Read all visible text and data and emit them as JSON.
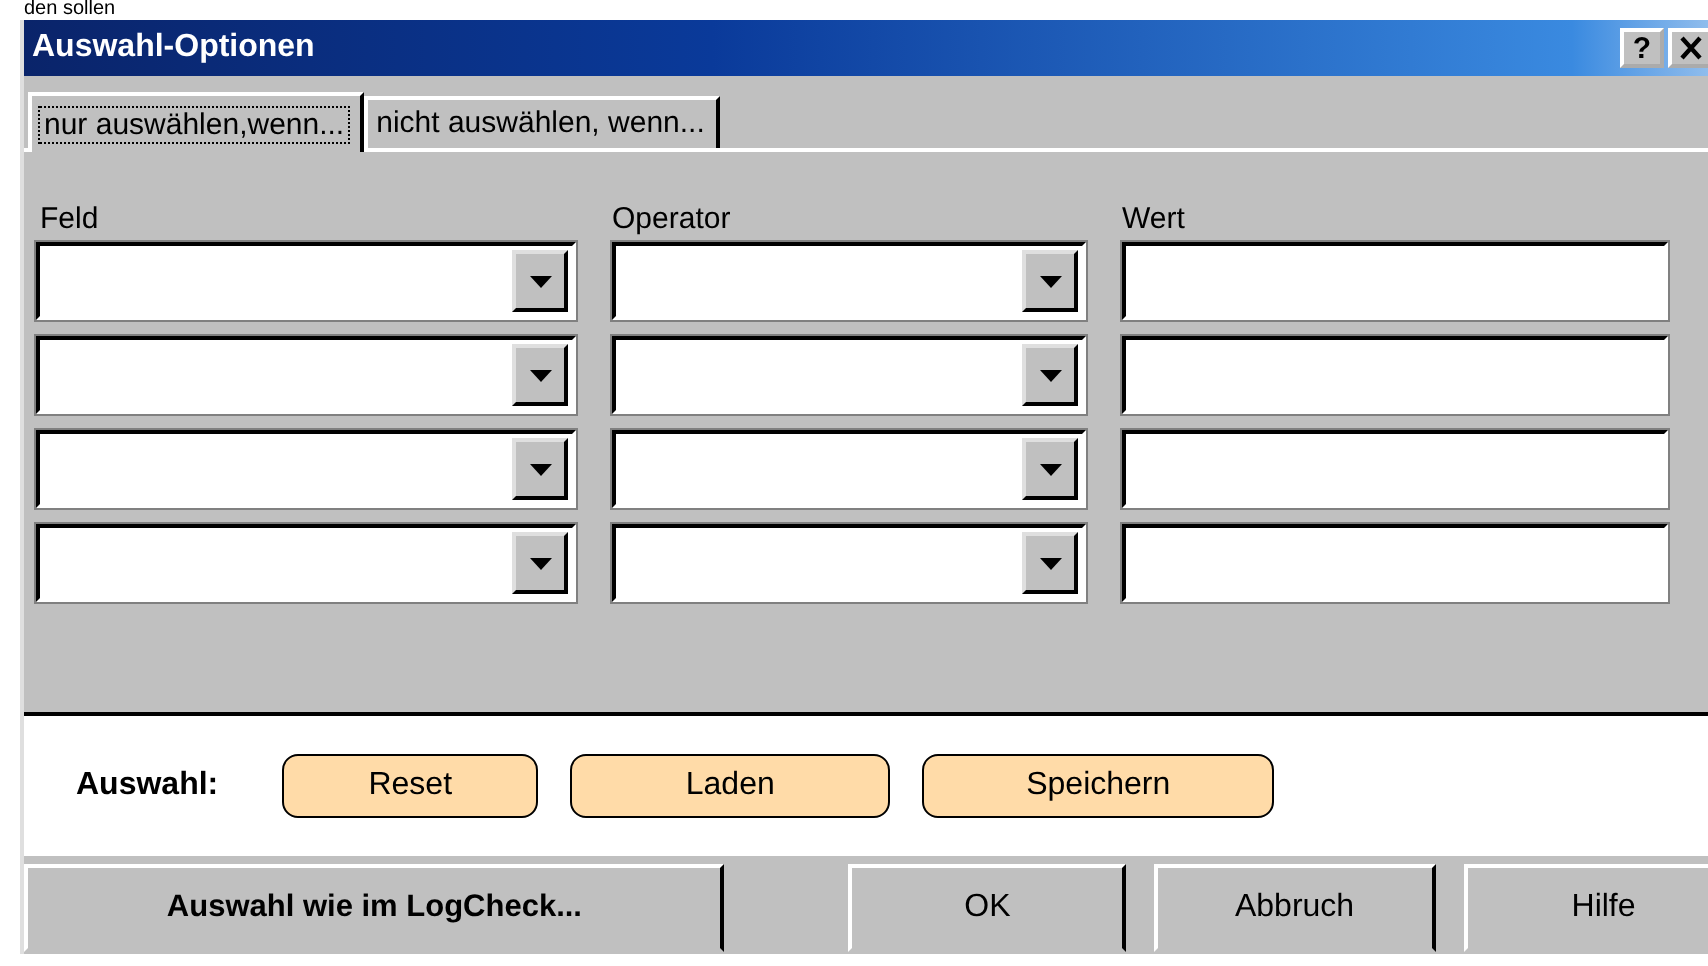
{
  "background_text": "den sollen",
  "window": {
    "title": "Auswahl-Optionen",
    "help_button": "?"
  },
  "tabs": [
    {
      "label": "nur auswählen,wenn...",
      "selected": true
    },
    {
      "label": "nicht auswählen, wenn...",
      "selected": false
    }
  ],
  "columns": [
    "Feld",
    "Operator",
    "Wert"
  ],
  "condition_rows": [
    {
      "cells": [
        {
          "kind": "dropdown"
        },
        {
          "kind": "dropdown"
        },
        {
          "kind": "text"
        }
      ]
    },
    {
      "cells": [
        {
          "kind": "dropdown"
        },
        {
          "kind": "dropdown"
        },
        {
          "kind": "text"
        }
      ]
    },
    {
      "cells": [
        {
          "kind": "dropdown"
        },
        {
          "kind": "dropdown"
        },
        {
          "kind": "text"
        }
      ]
    },
    {
      "cells": [
        {
          "kind": "dropdown"
        },
        {
          "kind": "dropdown"
        },
        {
          "kind": "text"
        }
      ]
    }
  ],
  "selection_bar": {
    "label": "Auswahl:",
    "buttons": [
      "Reset",
      "Laden",
      "Speichern"
    ]
  },
  "footer_buttons": [
    {
      "label": "Auswahl wie im LogCheck...",
      "kind": "wide"
    },
    {
      "label": "OK",
      "kind": "normal"
    },
    {
      "label": "Abbruch",
      "kind": "normal"
    },
    {
      "label": "Hilfe",
      "kind": "normal"
    }
  ]
}
